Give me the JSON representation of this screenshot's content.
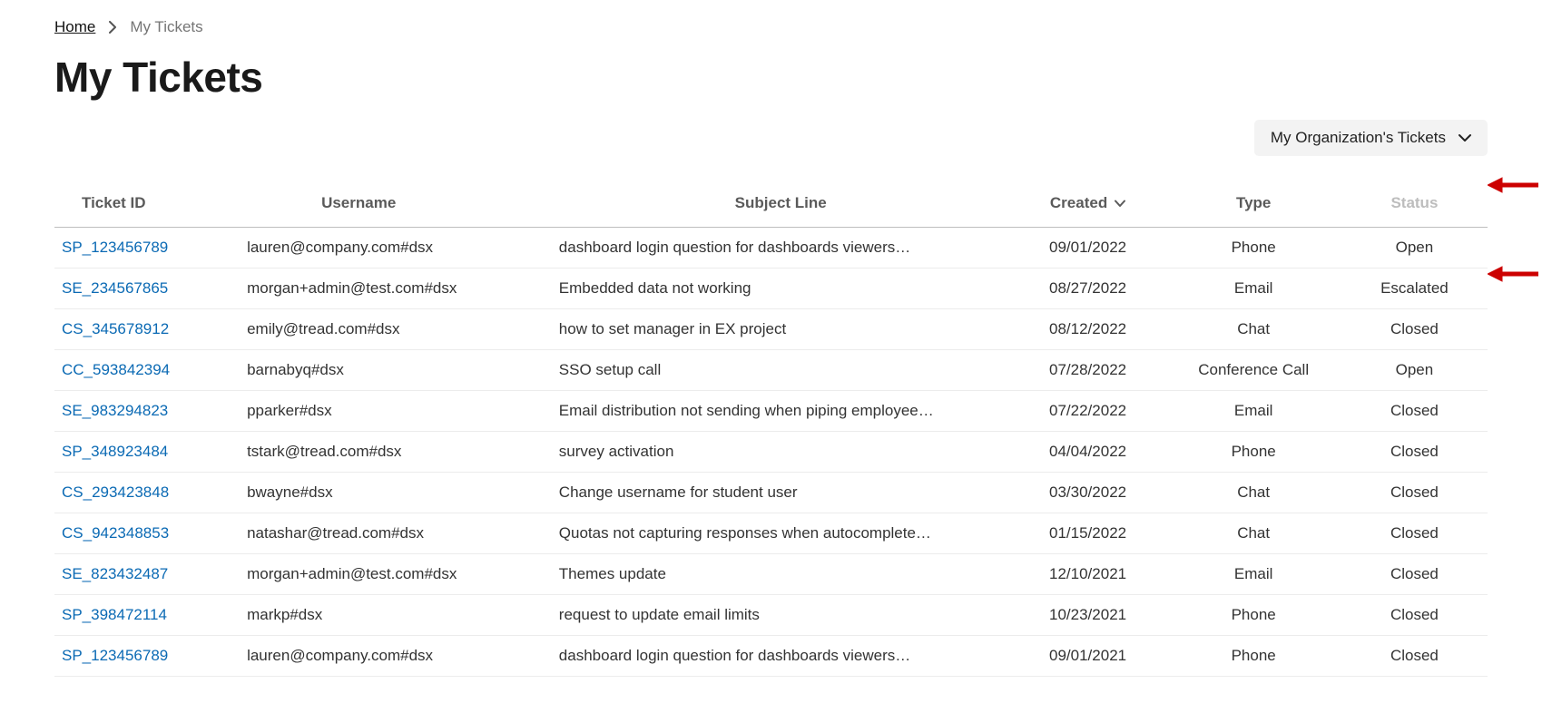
{
  "breadcrumb": {
    "home": "Home",
    "current": "My Tickets"
  },
  "page_title": "My Tickets",
  "filter": {
    "label": "My Organization's Tickets"
  },
  "table": {
    "columns": {
      "ticket_id": "Ticket ID",
      "username": "Username",
      "subject": "Subject Line",
      "created": "Created",
      "type": "Type",
      "status": "Status"
    },
    "sort_column": "created",
    "rows": [
      {
        "ticket_id": "SP_123456789",
        "username": "lauren@company.com#dsx",
        "subject": "dashboard login question for dashboards viewers…",
        "created": "09/01/2022",
        "type": "Phone",
        "status": "Open"
      },
      {
        "ticket_id": "SE_234567865",
        "username": "morgan+admin@test.com#dsx",
        "subject": "Embedded data not working",
        "created": "08/27/2022",
        "type": "Email",
        "status": "Escalated"
      },
      {
        "ticket_id": "CS_345678912",
        "username": "emily@tread.com#dsx",
        "subject": "how to set manager in EX project",
        "created": "08/12/2022",
        "type": "Chat",
        "status": "Closed"
      },
      {
        "ticket_id": "CC_593842394",
        "username": "barnabyq#dsx",
        "subject": "SSO setup call",
        "created": "07/28/2022",
        "type": "Conference Call",
        "status": "Open"
      },
      {
        "ticket_id": "SE_983294823",
        "username": "pparker#dsx",
        "subject": "Email distribution not sending when piping employee…",
        "created": "07/22/2022",
        "type": "Email",
        "status": "Closed"
      },
      {
        "ticket_id": "SP_348923484",
        "username": "tstark@tread.com#dsx",
        "subject": "survey activation",
        "created": "04/04/2022",
        "type": "Phone",
        "status": "Closed"
      },
      {
        "ticket_id": "CS_293423848",
        "username": "bwayne#dsx",
        "subject": "Change username for student user",
        "created": "03/30/2022",
        "type": "Chat",
        "status": "Closed"
      },
      {
        "ticket_id": "CS_942348853",
        "username": "natashar@tread.com#dsx",
        "subject": "Quotas not capturing responses when autocomplete…",
        "created": "01/15/2022",
        "type": "Chat",
        "status": "Closed"
      },
      {
        "ticket_id": "SE_823432487",
        "username": "morgan+admin@test.com#dsx",
        "subject": "Themes update",
        "created": "12/10/2021",
        "type": "Email",
        "status": "Closed"
      },
      {
        "ticket_id": "SP_398472114",
        "username": "markp#dsx",
        "subject": "request to update email limits",
        "created": "10/23/2021",
        "type": "Phone",
        "status": "Closed"
      },
      {
        "ticket_id": "SP_123456789",
        "username": "lauren@company.com#dsx",
        "subject": "dashboard login question for dashboards viewers…",
        "created": "09/01/2021",
        "type": "Phone",
        "status": "Closed"
      }
    ]
  }
}
